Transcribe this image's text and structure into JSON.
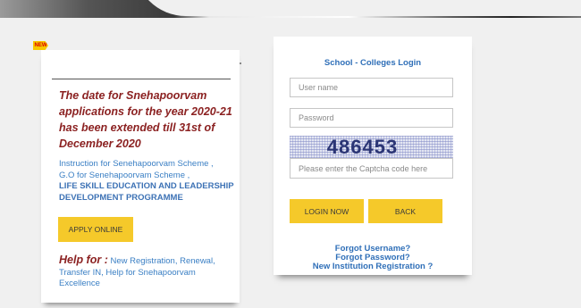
{
  "badge": {
    "new": "NEW"
  },
  "notice": "The date for Snehapoorvam applications for the year 2020-21 has been extended till 31st of December 2020",
  "links": {
    "instruction": "Instruction for Senehapoorvam Scheme ,",
    "go": "G.O for Senehapoorvam Scheme ,",
    "life_skill": "LIFE SKILL EDUCATION AND LEADERSHIP DEVELOPMENT PROGRAMME"
  },
  "apply_button": "APPLY ONLINE",
  "help": {
    "label": "Help for :",
    "text": "New Registration, Renewal, Transfer IN, Help for Snehapoorvam Excellence"
  },
  "login": {
    "title": "School - Colleges Login",
    "username_placeholder": "User name",
    "password_placeholder": "Password",
    "captcha_code": "486453",
    "captcha_placeholder": "Please enter the Captcha code here",
    "login_button": "LOGIN NOW",
    "back_button": "BACK",
    "forgot_username": "Forgot Username?",
    "forgot_password": "Forgot Password?",
    "new_registration": "New Institution Registration ?"
  },
  "colors": {
    "accent": "#f5c92a",
    "link": "#2f6fb8",
    "notice": "#8b2121"
  }
}
